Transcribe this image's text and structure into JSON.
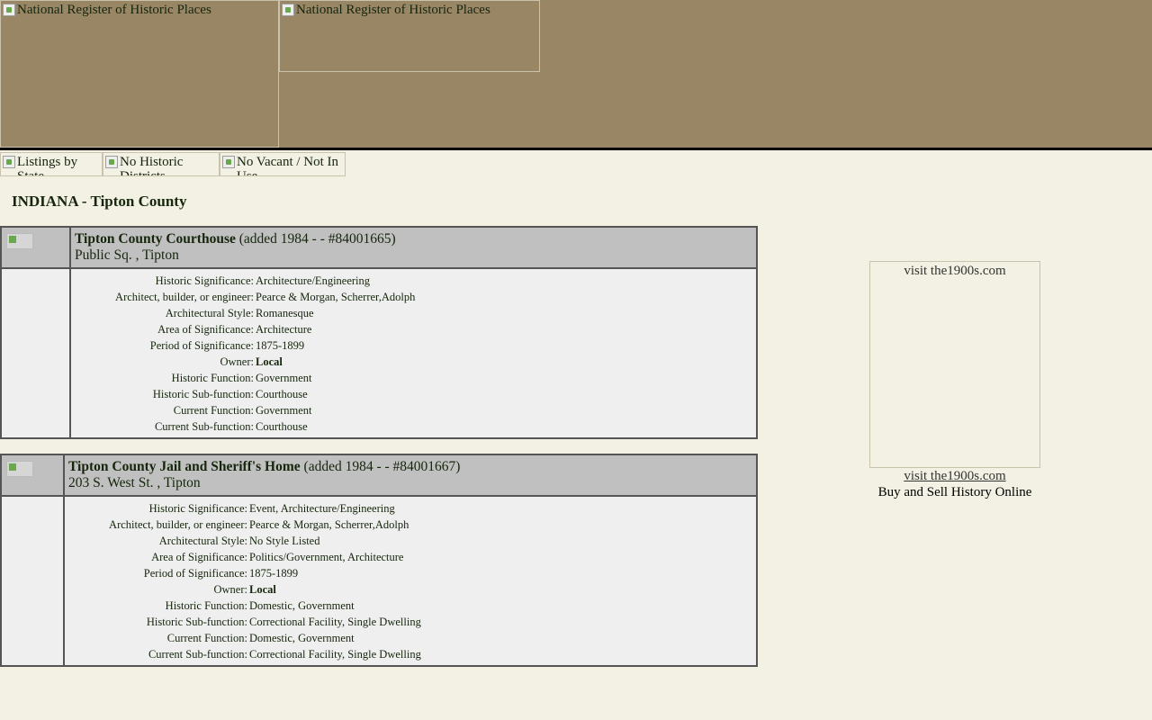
{
  "header": {
    "logo_alt_1": "National Register of Historic Places",
    "logo_alt_2": "National Register of Historic Places"
  },
  "nav": {
    "listings_by_state": "Listings by State",
    "no_historic_districts": "No Historic Districts",
    "no_vacant": "No Vacant / Not In Use"
  },
  "page_heading": "INDIANA - Tipton County",
  "listings": [
    {
      "name": "Tipton County Courthouse",
      "added": "(added 1984 - - #84001665)",
      "address": "Public Sq. , Tipton",
      "fields": [
        {
          "label": "Historic Significance:",
          "value": "Architecture/Engineering"
        },
        {
          "label": "Architect, builder, or engineer:",
          "value": "Pearce & Morgan, Scherrer,Adolph"
        },
        {
          "label": "Architectural Style:",
          "value": "Romanesque"
        },
        {
          "label": "Area of Significance:",
          "value": "Architecture"
        },
        {
          "label": "Period of Significance:",
          "value": "1875-1899"
        },
        {
          "label": "Owner:",
          "value": "Local"
        },
        {
          "label": "Historic Function:",
          "value": "Government"
        },
        {
          "label": "Historic Sub-function:",
          "value": "Courthouse"
        },
        {
          "label": "Current Function:",
          "value": "Government"
        },
        {
          "label": "Current Sub-function:",
          "value": "Courthouse"
        }
      ]
    },
    {
      "name": "Tipton County Jail and Sheriff's Home",
      "added": "(added 1984 - - #84001667)",
      "address": "203 S. West St. , Tipton",
      "fields": [
        {
          "label": "Historic Significance:",
          "value": "Event, Architecture/Engineering"
        },
        {
          "label": "Architect, builder, or engineer:",
          "value": "Pearce & Morgan, Scherrer,Adolph"
        },
        {
          "label": "Architectural Style:",
          "value": "No Style Listed"
        },
        {
          "label": "Area of Significance:",
          "value": "Politics/Government, Architecture"
        },
        {
          "label": "Period of Significance:",
          "value": "1875-1899"
        },
        {
          "label": "Owner:",
          "value": "Local"
        },
        {
          "label": "Historic Function:",
          "value": "Domestic, Government"
        },
        {
          "label": "Historic Sub-function:",
          "value": "Correctional Facility, Single Dwelling"
        },
        {
          "label": "Current Function:",
          "value": "Domestic, Government"
        },
        {
          "label": "Current Sub-function:",
          "value": "Correctional Facility, Single Dwelling"
        }
      ]
    }
  ],
  "ad": {
    "image_alt": "visit the1900s.com",
    "link_text": "visit the1900s.com",
    "tagline": "Buy and Sell History Online"
  }
}
